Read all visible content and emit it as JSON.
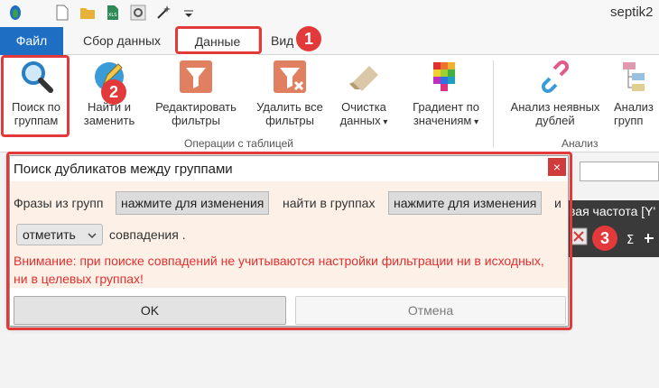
{
  "window": {
    "title": "septik2"
  },
  "tabs": [
    {
      "label": "Файл"
    },
    {
      "label": "Сбор данных"
    },
    {
      "label": "Данные"
    },
    {
      "label": "Вид"
    }
  ],
  "ribbon": {
    "buttons": [
      {
        "label": "Поиск по\nгруппам",
        "icon": "search-icon"
      },
      {
        "label": "Найти и\nзаменить",
        "icon": "find-replace-icon"
      },
      {
        "label": "Редактировать\nфильтры",
        "icon": "filter-icon"
      },
      {
        "label": "Удалить все\nфильтры",
        "icon": "filter-remove-icon"
      },
      {
        "label": "Очистка\nданных",
        "icon": "eraser-icon",
        "dropdown": true
      },
      {
        "label": "Градиент по\nзначениям",
        "icon": "gradient-icon",
        "dropdown": true
      },
      {
        "label": "Анализ неявных\nдублей",
        "icon": "link-broken-icon"
      },
      {
        "label": "Анализ\nгрупп",
        "icon": "hierarchy-icon"
      }
    ],
    "group_labels": {
      "table_ops": "Операции с таблицей",
      "analysis": "Анализ"
    }
  },
  "badges": [
    "1",
    "2",
    "3"
  ],
  "background": {
    "column_header": "вая частота [Y'"
  },
  "dialog": {
    "title": "Поиск дубликатов между группами",
    "close": "×",
    "text_phrases_from": "Фразы из групп",
    "pill_source": "нажмите для изменения",
    "text_find_in": "найти в группах",
    "pill_target": "нажмите для изменения",
    "text_and": "и",
    "action_value": "отметить",
    "text_matches": "совпадения .",
    "warning": "Внимание: при поиске совпадений не учитываются настройки фильтрации ни в исходных, ни в целевых группах!",
    "ok_label": "OK",
    "cancel_label": "Отмена"
  },
  "colors": {
    "accent": "#1e6fc4",
    "highlight": "#e23a3a",
    "dialog_bg": "#fdf1e7",
    "warning": "#e12f2f"
  }
}
